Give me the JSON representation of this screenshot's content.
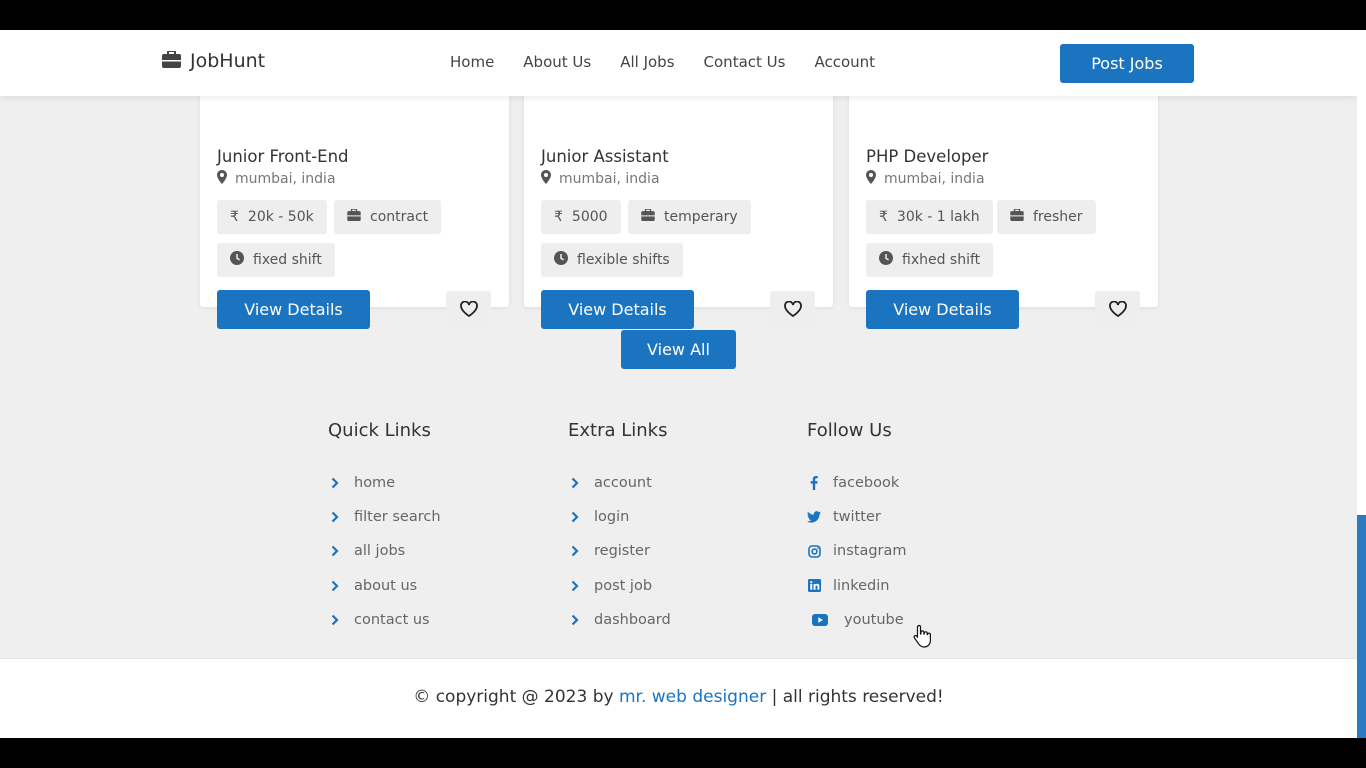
{
  "header": {
    "logo_text": "JobHunt",
    "nav": [
      "Home",
      "About Us",
      "All Jobs",
      "Contact Us",
      "Account"
    ],
    "post_button": "Post Jobs"
  },
  "jobs": [
    {
      "title": "Junior Front-End",
      "location": "mumbai, india",
      "salary": "20k - 50k",
      "type": "contract",
      "shift": "fixed shift",
      "button": "View Details"
    },
    {
      "title": "Junior Assistant",
      "location": "mumbai, india",
      "salary": "5000",
      "type": "temperary",
      "shift": "flexible shifts",
      "button": "View Details"
    },
    {
      "title": "PHP Developer",
      "location": "mumbai, india",
      "salary": "30k - 1 lakh",
      "type": "fresher",
      "shift": "fixhed shift",
      "button": "View Details"
    }
  ],
  "view_all": "View All",
  "footer": {
    "quick_links": {
      "title": "Quick Links",
      "items": [
        "home",
        "filter search",
        "all jobs",
        "about us",
        "contact us"
      ]
    },
    "extra_links": {
      "title": "Extra Links",
      "items": [
        "account",
        "login",
        "register",
        "post job",
        "dashboard"
      ]
    },
    "follow_us": {
      "title": "Follow Us",
      "items": [
        "facebook",
        "twitter",
        "instagram",
        "linkedin",
        "youtube"
      ]
    }
  },
  "copyright": {
    "prefix": "© copyright @ 2023 by ",
    "author": "mr. web designer",
    "suffix": " | all rights reserved!"
  },
  "colors": {
    "accent": "#1a74c0",
    "background": "#efefef",
    "tag": "#eeeeee"
  },
  "icons": [
    "briefcase-icon",
    "map-marker-icon",
    "rupee-icon",
    "clock-icon",
    "heart-icon",
    "chevron-right-icon",
    "facebook-icon",
    "twitter-icon",
    "instagram-icon",
    "linkedin-icon",
    "youtube-icon",
    "hand-pointer-icon"
  ]
}
